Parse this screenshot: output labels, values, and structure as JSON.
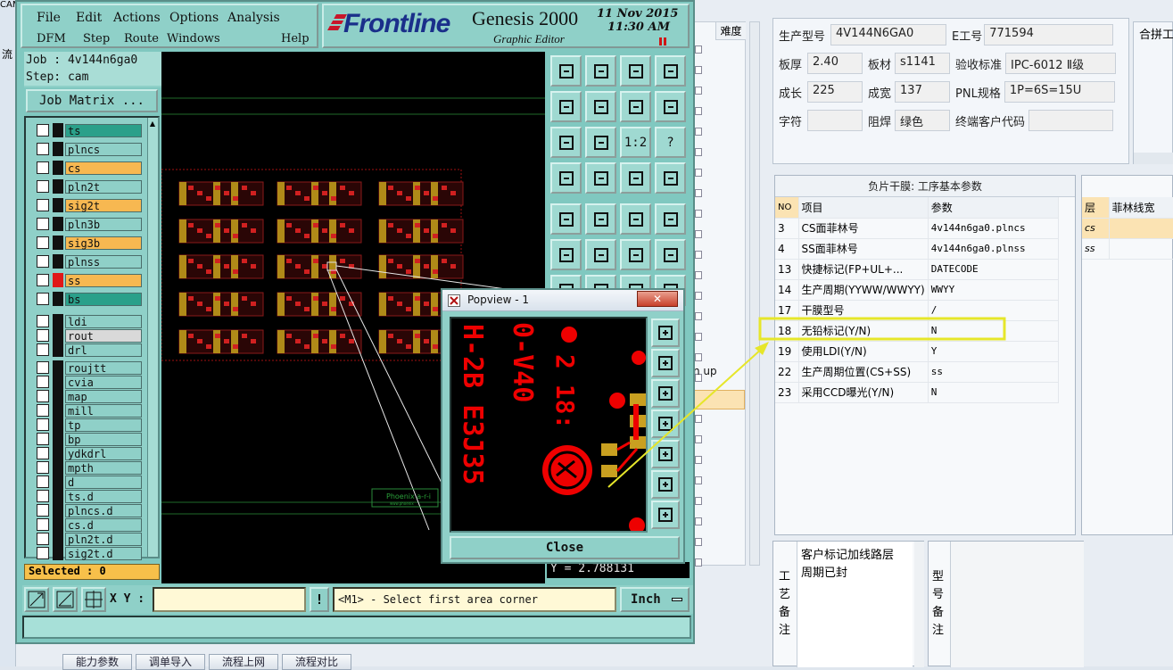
{
  "erp": {
    "left_fragments": {
      "cam": "CAM",
      "flow": "流"
    },
    "fields": {
      "model_label": "生产型号",
      "model_value": "4V144N6GA0",
      "e_label": "E工号",
      "e_value": "771594",
      "thickness_label": "板厚",
      "thickness_value": "2.40",
      "material_label": "板材",
      "material_value": "s1141",
      "standard_label": "验收标准",
      "standard_value": "IPC-6012 Ⅱ级",
      "length_label": "成长",
      "length_value": "225",
      "width_label": "成宽",
      "width_value": "137",
      "pnl_label": "PNL规格",
      "pnl_value": "1P=6S=15U",
      "char_label": "字符",
      "char_value": "",
      "mask_label": "阻焊",
      "mask_value": "绿色",
      "customer_label": "终端客户代码",
      "customer_value": ""
    },
    "merge_label": "合拼工",
    "difficulty_header": "难度",
    "partial_button_text": "n up",
    "film_panel": {
      "title": "负片干膜: 工序基本参数",
      "headers": [
        "NO",
        "项目",
        "参数"
      ],
      "rows": [
        {
          "no": "3",
          "item": "CS面菲林号",
          "param": "4v144n6ga0.plncs"
        },
        {
          "no": "4",
          "item": "SS面菲林号",
          "param": "4v144n6ga0.plnss"
        },
        {
          "no": "13",
          "item": "快捷标记(FP+UL+...",
          "param": "DATECODE"
        },
        {
          "no": "14",
          "item": "生产周期(YYWW/WWYY)",
          "param": "WWYY"
        },
        {
          "no": "17",
          "item": "干膜型号",
          "param": "/"
        },
        {
          "no": "18",
          "item": "无铅标记(Y/N)",
          "param": "N"
        },
        {
          "no": "19",
          "item": "使用LDI(Y/N)",
          "param": "Y"
        },
        {
          "no": "22",
          "item": "生产周期位置(CS+SS)",
          "param": "ss"
        },
        {
          "no": "23",
          "item": "采用CCD曝光(Y/N)",
          "param": "N"
        }
      ]
    },
    "layer_panel": {
      "headers": [
        "层",
        "菲林线宽"
      ],
      "rows": [
        "cs",
        "ss"
      ]
    },
    "process_note_label": "工艺备注",
    "process_note_text": [
      "客户标记加线路层",
      "周期已封"
    ],
    "model_note_label": "型号备注",
    "bottom_buttons": [
      "能力参数",
      "调单导入",
      "流程上网",
      "流程对比"
    ]
  },
  "genesis": {
    "menu_row1": [
      "File",
      "Edit",
      "Actions",
      "Options",
      "Analysis"
    ],
    "menu_row2": [
      "DFM",
      "Step",
      "Route",
      "Windows",
      "Help"
    ],
    "brand": "Frontline",
    "product": "Genesis 2000",
    "subtitle": "Graphic Editor",
    "date": "11 Nov 2015",
    "time": "11:30 AM",
    "job": "Job : 4v144n6ga0",
    "step": "Step: cam",
    "job_matrix": "Job Matrix ...",
    "layers": [
      {
        "name": "ts",
        "color": "#2aa08a"
      },
      {
        "name": "plncs",
        "color": "#8fd0c8"
      },
      {
        "name": "cs",
        "color": "#f7b851"
      },
      {
        "name": "pln2t",
        "color": "#8fd0c8"
      },
      {
        "name": "sig2t",
        "color": "#f7b851"
      },
      {
        "name": "pln3b",
        "color": "#8fd0c8"
      },
      {
        "name": "sig3b",
        "color": "#f7b851"
      },
      {
        "name": "plnss",
        "color": "#8fd0c8"
      },
      {
        "name": "ss",
        "color": "#f7b851"
      },
      {
        "name": "bs",
        "color": "#2aa08a"
      },
      {
        "name": "ldi",
        "color": "#8fd0c8"
      },
      {
        "name": "rout",
        "color": "#d9d9d9"
      },
      {
        "name": "drl",
        "color": "#8fd0c8"
      },
      {
        "name": "roujtt",
        "color": "#8fd0c8"
      },
      {
        "name": "cvia",
        "color": "#8fd0c8"
      },
      {
        "name": "map",
        "color": "#8fd0c8"
      },
      {
        "name": "mill",
        "color": "#8fd0c8"
      },
      {
        "name": "tp",
        "color": "#8fd0c8"
      },
      {
        "name": "bp",
        "color": "#8fd0c8"
      },
      {
        "name": "ydkdrl",
        "color": "#8fd0c8"
      },
      {
        "name": "mpth",
        "color": "#8fd0c8"
      },
      {
        "name": "d",
        "color": "#8fd0c8"
      },
      {
        "name": "ts.d",
        "color": "#8fd0c8"
      },
      {
        "name": "plncs.d",
        "color": "#8fd0c8"
      },
      {
        "name": "cs.d",
        "color": "#8fd0c8"
      },
      {
        "name": "pln2t.d",
        "color": "#8fd0c8"
      },
      {
        "name": "sig2t.d",
        "color": "#8fd0c8"
      }
    ],
    "selected": "Selected : 0",
    "xy_label": "X Y :",
    "status_message": "<M1> - Select first area corner",
    "units": "Inch",
    "y_readout": "Y = 2.788131",
    "tool_labels": {
      "one_to_two": "1:2",
      "help": "?"
    },
    "canvas_text": {
      "logo": "Phoenix a-r-i",
      "logo_small": "www.phoenix"
    }
  },
  "popview": {
    "title": "Popview - 1",
    "close_button": "Close",
    "art_text": [
      "H-2B E3J35",
      "0-V40",
      "2 18:"
    ]
  }
}
